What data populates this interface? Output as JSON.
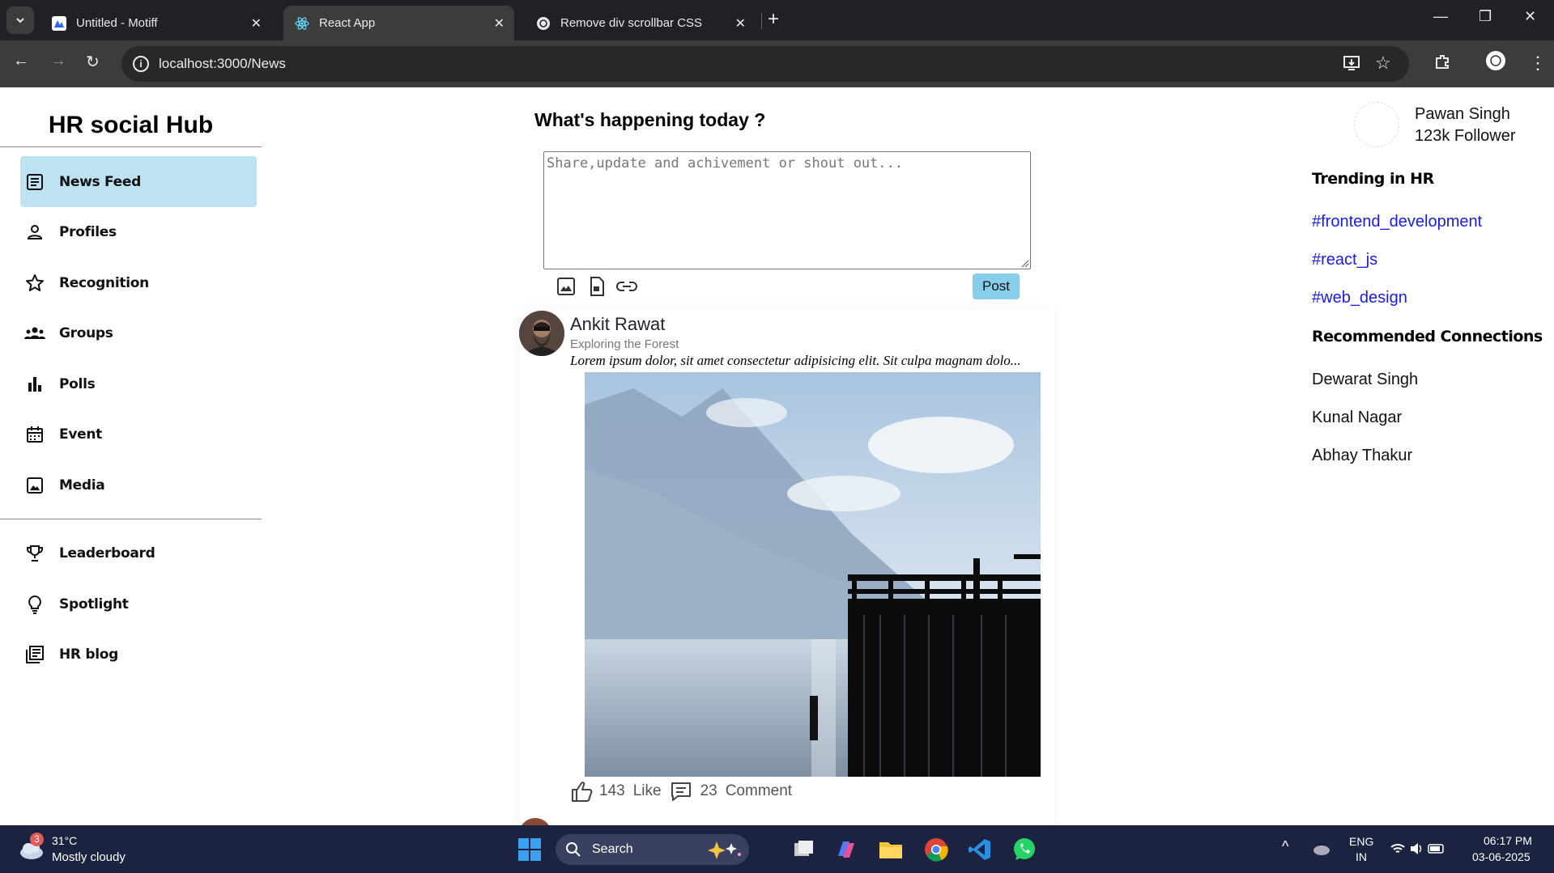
{
  "browser": {
    "tabs": [
      {
        "title": "Untitled - Motiff",
        "active": false
      },
      {
        "title": "React App",
        "active": true
      },
      {
        "title": "Remove div scrollbar CSS",
        "active": false
      }
    ],
    "url": "localhost:3000/News"
  },
  "sidebar": {
    "brand": "HR social Hub",
    "items": [
      {
        "label": "News Feed",
        "icon": "article-icon",
        "active": true
      },
      {
        "label": "Profiles",
        "icon": "person-icon"
      },
      {
        "label": "Recognition",
        "icon": "star-icon"
      },
      {
        "label": "Groups",
        "icon": "groups-icon"
      },
      {
        "label": "Polls",
        "icon": "bar-chart-icon"
      },
      {
        "label": "Event",
        "icon": "calendar-icon"
      },
      {
        "label": "Media",
        "icon": "image-icon"
      }
    ],
    "secondary": [
      {
        "label": "Leaderboard",
        "icon": "trophy-icon"
      },
      {
        "label": "Spotlight",
        "icon": "lightbulb-icon"
      },
      {
        "label": "HR blog",
        "icon": "blog-icon"
      }
    ]
  },
  "composer": {
    "title": "What's happening today ?",
    "placeholder": "Share,update and achivement or shout out...",
    "post_label": "Post"
  },
  "post": {
    "author": "Ankit Rawat",
    "subtitle": "Exploring the Forest",
    "text": "Lorem ipsum dolor, sit amet consectetur adipisicing elit. Sit culpa magnam dolo...",
    "likes": "143",
    "like_label": "Like",
    "comments": "23",
    "comment_label": "Comment"
  },
  "profile": {
    "name": "Pawan Singh",
    "followers": "123k Follower"
  },
  "trending": {
    "title": "Trending in HR",
    "tags": [
      "#frontend_development",
      "#react_js",
      "#web_design"
    ]
  },
  "recommended": {
    "title": "Recommended Connections",
    "people": [
      "Dewarat Singh",
      "Kunal Nagar",
      "Abhay Thakur"
    ]
  },
  "taskbar": {
    "weather_badge": "3",
    "temp": "31°C",
    "condition": "Mostly cloudy",
    "search_label": "Search",
    "lang1": "ENG",
    "lang2": "IN",
    "time": "06:17 PM",
    "date": "03-06-2025"
  },
  "colors": {
    "active_nav": "#bde3f2",
    "post_button": "#87ceeb",
    "tag_link": "#1a1aee"
  }
}
